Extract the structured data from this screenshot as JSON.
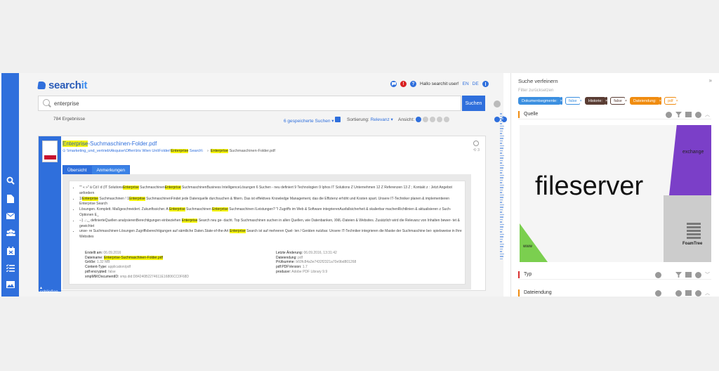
{
  "app": {
    "logo_text": "search",
    "logo_suffix": "it"
  },
  "header": {
    "greeting": "Hallo searchit user!",
    "lang_en": "EN",
    "lang_de": "DE",
    "alert_glyph": "!",
    "help_glyph": "?"
  },
  "search": {
    "query": "enterprise",
    "button_label": "Suchen"
  },
  "results": {
    "count": "784 Ergebnisse",
    "saved_searches": "6 gespeicherte Suchen ▾",
    "sort_label": "Sortierung:",
    "sort_value": "Relevanz ▾",
    "view_label": "Ansicht:"
  },
  "result": {
    "title_hl": "Enterprise",
    "title_rest": "-Suchmaschinen-Folder.pdf",
    "path": "\\\\marketing_und_vertrieb\\Akquise\\Offen\\Iris Wien Uni\\Folder\\",
    "path_hl": "Enterprise",
    "path_rest": " Search\\",
    "path_file_hl": "Enterprise",
    "path_file_rest": " Suchmaschinen-Folder.pdf",
    "count_badge": "3",
    "tab_overview": "Übersicht",
    "tab_notes": "Anmerkungen",
    "close_label": "▴ schließen",
    "snippets": [
      {
        "pre": "\"\" « »\" à Cd I d (IT Solutions",
        "hl": "Enterprise",
        "post": " Suchmaschinen",
        "hl2": "Enterprise",
        "post2": " SuchmaschinenBusiness IntelligenceLösungen 6 Suchen - neu definiert 9 Technologien 9 Iphos IT Solutions Z Unternehmen 12 Z Referenzen 13 Z ; Kontakt z : Jetzt Angebot anfordern"
      },
      {
        "pre": "1\\",
        "hl": "Enterprise",
        "post": " Suchmaschinen ! 1",
        "hl2": "Enterprise",
        "post2": " SuchmaschinenFindet jede Datenquelle durchsuchen & filtern. Das ist effektives Knowledge Management, das die Effizienz erhöht und Kosten spart. Unsere IT-Techniker planen & implementieren Enterprise Search"
      },
      {
        "pre": "Lösungen. Komplett. Maßgeschneidert. Zukunftssicher. A ",
        "hl": "Enterprise",
        "post": " Suchmaschinen ",
        "hl2": "Enterprise",
        "post2": " Suchmaschinen ILeistungen? \"I Zugriffs im Web & Software integrierenAusfallsicherheit & skalierbar machenRichtlinien & aktualisieren z Such-Optionen E_"
      },
      {
        "pre": "--} ..:,_ definierteQuellen analysierenBerechtigungen einbeziehen ",
        "hl": "Enterprise",
        "post": " Search neu ge- dacht. Top Suchmaschinen suchen in allen Quellen, wie Datenbanken, XML-Dateien & Websites. Zusätzlich wird die Relevanz von Inhalten bewer- tet & gewichtet",
        "hl2": "",
        "post2": ""
      },
      {
        "pre": "unse- re Suchmaschinen-Lösungen Zugriffsberechtigungen auf sämtliche Daten.State-of-the-Art ",
        "hl": "Enterprise",
        "post": " Search ist auf mehreren Quel- len / Geräten nutzbar. Unsere IT-Techniker integrieren die Maske der Suchmaschine bei- spielsweise in Ihre Websites",
        "hl2": "",
        "post2": ""
      }
    ],
    "meta_left": [
      {
        "k": "Erstellt am:",
        "v": "06.09.2016"
      },
      {
        "k": "Dateiname:",
        "v": "Enterprise-Suchmaschinen-Folder.pdf"
      },
      {
        "k": "Größe:",
        "v": "1.32 MB"
      },
      {
        "k": "Content-Type:",
        "v": "application/pdf"
      },
      {
        "k": "pdf:encrypted:",
        "v": "false"
      },
      {
        "k": "xmpMM:DocumentID:",
        "v": "xmp.did:D84240B2274611E16806CC0F68D"
      }
    ],
    "meta_right": [
      {
        "k": "Letzte Änderung:",
        "v": "06.09.2016, 13:31:42"
      },
      {
        "k": "Dateiendung:",
        "v": "pdf"
      },
      {
        "k": "Prüfsumme:",
        "v": "b60fc84a3e7432f2321a70e9bd801268"
      },
      {
        "k": "pdf:PDFVersion:",
        "v": "1.7"
      },
      {
        "k": "producer:",
        "v": "Adobe PDF Library 9.9"
      }
    ]
  },
  "refine": {
    "title": "Suche verfeinern",
    "reset": "Filter zurücksetzen",
    "chips": [
      {
        "label": "Dokumentsegmente:",
        "color": "#3b8fe0",
        "text_color": "#ffffff"
      },
      {
        "label": "false",
        "color": "#ffffff",
        "text_color": "#3b8fe0"
      },
      {
        "label": "Historie:",
        "color": "#5a3d34",
        "text_color": "#ffffff"
      },
      {
        "label": "false",
        "color": "#ffffff",
        "text_color": "#5a3d34"
      },
      {
        "label": "Dateiendung:",
        "color": "#f08c10",
        "text_color": "#ffffff"
      },
      {
        "label": "pdf",
        "color": "#ffffff",
        "text_color": "#f08c10"
      }
    ],
    "facets": [
      {
        "label": "Quelle",
        "color": "#f08c10"
      },
      {
        "label": "Typ",
        "color": "#d83030"
      },
      {
        "label": "Dateiendung",
        "color": "#f08c10"
      }
    ],
    "cloud": {
      "main": "fileserver",
      "exchange": "exchange",
      "www": "www",
      "foamtree": "FoamTree"
    }
  },
  "colors": {
    "accent": "#2f6fdc",
    "highlight": "#f5f50a"
  }
}
